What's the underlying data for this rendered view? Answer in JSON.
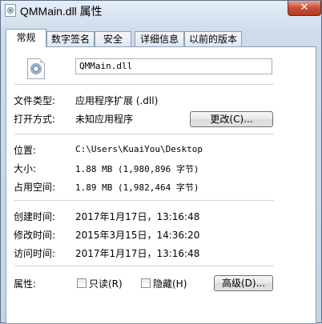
{
  "window": {
    "title": "QMMain.dll 属性",
    "close_glyph": "✕"
  },
  "tabs": [
    {
      "label": "常规",
      "active": true
    },
    {
      "label": "数字签名",
      "active": false
    },
    {
      "label": "安全",
      "active": false
    },
    {
      "label": "详细信息",
      "active": false
    },
    {
      "label": "以前的版本",
      "active": false
    }
  ],
  "general": {
    "file_name": "QMMain.dll",
    "file_type_label": "文件类型:",
    "file_type_value": "应用程序扩展 (.dll)",
    "open_with_label": "打开方式:",
    "open_with_value": "未知应用程序",
    "change_button": "更改(C)...",
    "location_label": "位置:",
    "location_value": "C:\\Users\\KuaiYou\\Desktop",
    "size_label": "大小:",
    "size_value": "1.88 MB (1,980,896 字节)",
    "size_on_disk_label": "占用空间:",
    "size_on_disk_value": "1.89 MB (1,982,464 字节)",
    "created_label": "创建时间:",
    "created_value": "2017年1月17日，13:16:48",
    "modified_label": "修改时间:",
    "modified_value": "2015年3月15日，14:36:20",
    "accessed_label": "访问时间:",
    "accessed_value": "2017年1月17日，13:16:48",
    "attributes_label": "属性:",
    "readonly_label": "只读(R)",
    "readonly_checked": false,
    "hidden_label": "隐藏(H)",
    "hidden_checked": false,
    "advanced_button": "高级(D)..."
  },
  "icons": {
    "title_icon": "dll-file-icon",
    "file_icon": "dll-file-icon"
  }
}
